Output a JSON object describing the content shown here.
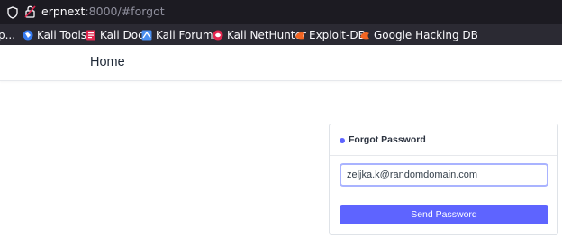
{
  "browser": {
    "url_host": "erpnext",
    "url_rest": ":8000/#forgot",
    "bookmarks": [
      {
        "label": "p...",
        "icon": "kali-dragon-icon"
      },
      {
        "label": "Kali Tools",
        "icon": "kali-tools-icon"
      },
      {
        "label": "Kali Docs",
        "icon": "kali-docs-icon"
      },
      {
        "label": "Kali Forums",
        "icon": "kali-forums-icon"
      },
      {
        "label": "Kali NetHunter",
        "icon": "kali-nethunter-icon"
      },
      {
        "label": "Exploit-DB",
        "icon": "exploit-db-icon"
      },
      {
        "label": "Google Hacking DB",
        "icon": "google-hacking-db-icon"
      }
    ]
  },
  "navbar": {
    "brand": "Home"
  },
  "forgot": {
    "title": "Forgot Password",
    "email_value": "zeljka.k@randomdomain.com",
    "submit_label": "Send Password",
    "accent_color": "#5e64ff"
  }
}
